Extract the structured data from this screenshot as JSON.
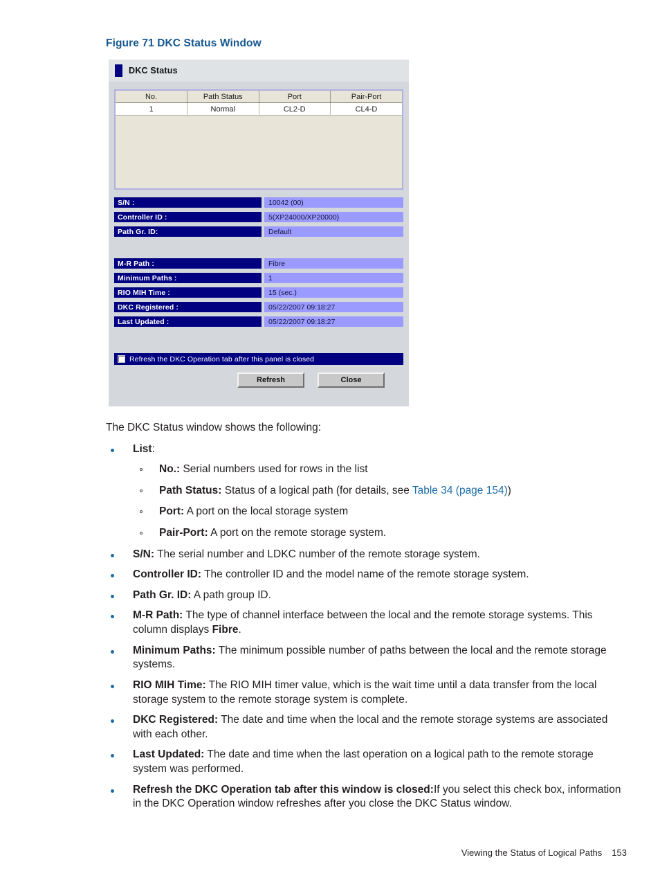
{
  "figure": {
    "caption": "Figure 71 DKC Status Window"
  },
  "screenshot": {
    "panel_title": "DKC Status",
    "list": {
      "columns": [
        "No.",
        "Path Status",
        "Port",
        "Pair-Port"
      ],
      "rows": [
        [
          "1",
          "Normal",
          "CL2-D",
          "CL4-D"
        ]
      ]
    },
    "fields_group_1": [
      {
        "label": "S/N :",
        "value": "10042 (00)"
      },
      {
        "label": "Controller ID :",
        "value": "5(XP24000/XP20000)"
      },
      {
        "label": "Path Gr. ID:",
        "value": "Default"
      }
    ],
    "fields_group_2": [
      {
        "label": "M-R Path :",
        "value": "Fibre"
      },
      {
        "label": "Minimum Paths :",
        "value": "1"
      },
      {
        "label": "RIO MIH Time :",
        "value": "15 (sec.)"
      },
      {
        "label": "DKC Registered :",
        "value": "05/22/2007 09:18:27"
      },
      {
        "label": "Last Updated :",
        "value": "05/22/2007 09:18:27"
      }
    ],
    "checkbox": {
      "label": "Refresh the DKC Operation tab after this panel is closed",
      "checked": false
    },
    "buttons": {
      "refresh": "Refresh",
      "close": "Close"
    },
    "colors": {
      "label_bar": "#000080",
      "value_field": "#9a9aff",
      "panel_background": "#d4d8dc",
      "list_background": "#e8e4d8"
    }
  },
  "body": {
    "intro": "The DKC Status window shows the following:",
    "items": [
      {
        "term": "List",
        "after_term": ":",
        "text": "",
        "subitems": [
          {
            "term": "No.:",
            "text": " Serial numbers used for rows in the list"
          },
          {
            "term": "Path Status:",
            "text": " Status of a logical path (for details, see ",
            "link": "Table 34 (page 154)",
            "text_after": ")"
          },
          {
            "term": "Port:",
            "text": " A port on the local storage system"
          },
          {
            "term": "Pair-Port:",
            "text": " A port on the remote storage system."
          }
        ]
      },
      {
        "term": "S/N:",
        "text": " The serial number and LDKC number of the remote storage system."
      },
      {
        "term": "Controller ID:",
        "text": " The controller ID and the model name of the remote storage system."
      },
      {
        "term": "Path Gr. ID:",
        "text": " A path group ID."
      },
      {
        "term": "M-R Path:",
        "text": " The type of channel interface between the local and the remote storage systems. This column displays ",
        "emphasis": "Fibre",
        "text_after": "."
      },
      {
        "term": "Minimum Paths:",
        "text": " The minimum possible number of paths between the local and the remote storage systems."
      },
      {
        "term": "RIO MIH Time:",
        "text": " The RIO MIH timer value, which is the wait time until a data transfer from the local storage system to the remote storage system is complete."
      },
      {
        "term": "DKC Registered:",
        "text": " The date and time when the local and the remote storage systems are associated with each other."
      },
      {
        "term": "Last Updated:",
        "text": " The date and time when the last operation on a logical path to the remote storage system was performed."
      },
      {
        "term": "Refresh the DKC Operation tab after this window is closed:",
        "text": "If you select this check box, information in the DKC Operation window refreshes after you close the DKC Status window."
      }
    ]
  },
  "footer": {
    "section": "Viewing the Status of Logical Paths",
    "page": "153"
  }
}
